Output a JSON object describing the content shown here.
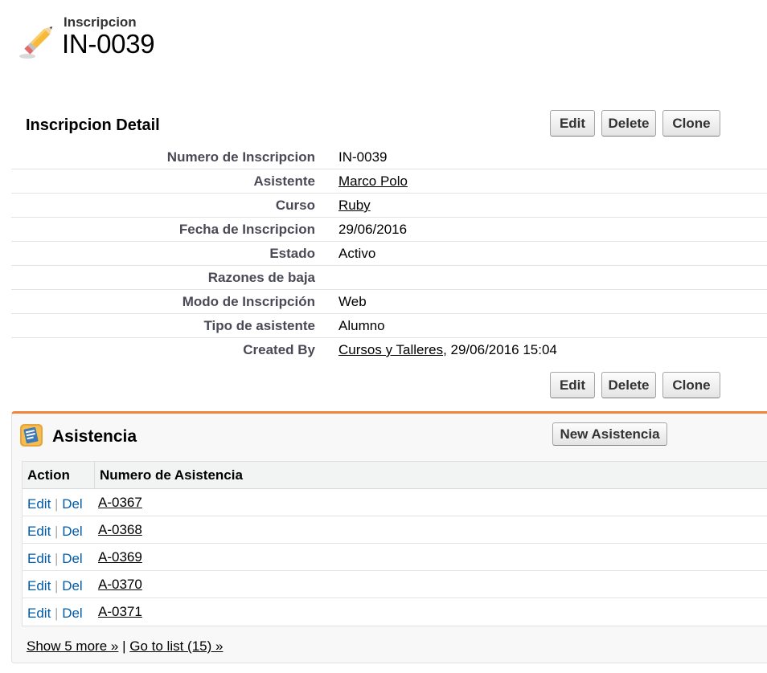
{
  "header": {
    "object_type": "Inscripcion",
    "record_name": "IN-0039"
  },
  "detail": {
    "title": "Inscripcion Detail",
    "buttons": {
      "edit": "Edit",
      "delete": "Delete",
      "clone": "Clone"
    },
    "fields": [
      {
        "label": "Numero de Inscripcion",
        "value": "IN-0039"
      },
      {
        "label": "Asistente",
        "value": "Marco Polo"
      },
      {
        "label": "Curso",
        "value": "Ruby"
      },
      {
        "label": "Fecha de Inscripcion",
        "value": "29/06/2016"
      },
      {
        "label": "Estado",
        "value": "Activo"
      },
      {
        "label": "Razones de baja",
        "value": ""
      },
      {
        "label": "Modo de Inscripción",
        "value": "Web"
      },
      {
        "label": "Tipo de asistente",
        "value": "Alumno"
      },
      {
        "label": "Created By",
        "value": "Cursos y Talleres",
        "suffix": ", 29/06/2016 15:04"
      }
    ]
  },
  "related_list": {
    "title": "Asistencia",
    "new_button": "New Asistencia",
    "columns": [
      "Action",
      "Numero de Asistencia"
    ],
    "action_edit": "Edit",
    "action_sep": "|",
    "action_del": "Del",
    "rows": [
      "A-0367",
      "A-0368",
      "A-0369",
      "A-0370",
      "A-0371"
    ],
    "footer": {
      "show_more": "Show 5 more »",
      "separator": "|",
      "go_to_list": "Go to list (15) »"
    }
  },
  "colors": {
    "accent": "#f0843c",
    "link": "#015ba7"
  },
  "icons": {
    "page": "pencil-icon",
    "related": "asistencia-icon"
  }
}
